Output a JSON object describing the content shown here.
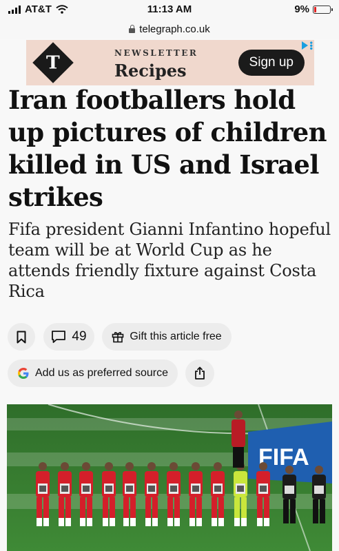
{
  "status_bar": {
    "carrier": "AT&T",
    "time": "11:13 AM",
    "battery": "9%",
    "battery_level": 0.09
  },
  "browser": {
    "url": "telegraph.co.uk"
  },
  "ad": {
    "logo_letter": "T",
    "kicker": "NEWSLETTER",
    "title": "Recipes",
    "cta": "Sign up"
  },
  "article": {
    "headline": "Iran footballers hold up pictures of children killed in US and Israel strikes",
    "standfirst": "Fifa president Gianni Infantino hopeful team will be at World Cup as he attends friendly fixture against Costa Rica"
  },
  "actions": {
    "comment_count": "49",
    "gift_label": "Gift this article free",
    "preferred_source_label": "Add us as preferred source"
  },
  "photo": {
    "banner_text": "FIFA"
  }
}
